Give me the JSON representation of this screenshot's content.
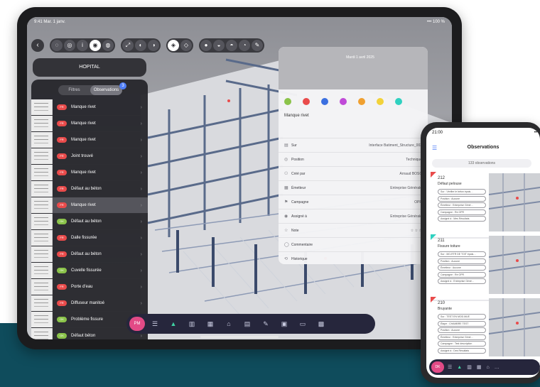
{
  "colors": {
    "teal_band": "#0f4c5c",
    "accent_pink": "#e24a86",
    "accent_green": "#3fd1a3",
    "badge_red": "#e94b4b",
    "badge_green": "#8bc34a"
  },
  "tablet": {
    "status_left": "9:41  Mar. 1 janv.",
    "status_right": "•••  100 %",
    "toolbar": {
      "back_icon": "back-arrow-icon",
      "groups": [
        [
          "tool-a-icon",
          "tool-b-icon",
          "info-icon",
          "view-icon",
          "tool-c-icon"
        ],
        [
          "expand-icon",
          "tool-d-icon",
          "tool-e-icon"
        ],
        [
          "layer-icon",
          "tool-f-icon"
        ],
        [
          "tool-g-icon",
          "tool-h-icon",
          "tool-i-icon",
          "tool-j-icon",
          "pen-icon"
        ]
      ]
    },
    "project_name": "HOPITAL",
    "segments": {
      "filters": "Filtres",
      "observations": "Observations",
      "badge": "3"
    },
    "observations": [
      {
        "badge": "red",
        "badge_text": "FR",
        "title": "Manque rivet"
      },
      {
        "badge": "red",
        "badge_text": "FR",
        "title": "Manque rivet"
      },
      {
        "badge": "red",
        "badge_text": "FR",
        "title": "Manque rivet"
      },
      {
        "badge": "red",
        "badge_text": "FR",
        "title": "Joint trouvé"
      },
      {
        "badge": "red",
        "badge_text": "FR",
        "title": "Manque rivet"
      },
      {
        "badge": "red",
        "badge_text": "FR",
        "title": "Défaut au béton"
      },
      {
        "badge": "red",
        "badge_text": "FR",
        "title": "Manque rivet"
      },
      {
        "badge": "green",
        "badge_text": "OK",
        "title": "Défaut au béton"
      },
      {
        "badge": "red",
        "badge_text": "FR",
        "title": "Dalle fissurée"
      },
      {
        "badge": "red",
        "badge_text": "FR",
        "title": "Défaut au béton"
      },
      {
        "badge": "green",
        "badge_text": "OK",
        "title": "Cuvelle fissurée"
      },
      {
        "badge": "red",
        "badge_text": "FR",
        "title": "Porte d'eau"
      },
      {
        "badge": "red",
        "badge_text": "FR",
        "title": "Diffuseur manitoé"
      },
      {
        "badge": "green",
        "badge_text": "OK",
        "title": "Problème fissure"
      },
      {
        "badge": "green",
        "badge_text": "OK",
        "title": "Défaut béton"
      }
    ],
    "detail": {
      "header": "Mardi 1 avril 2025",
      "title": "Manque rivet",
      "color_swatches": [
        "#8bc34a",
        "#e94b4b",
        "#3b6fe0",
        "#c04ad8",
        "#f0a030",
        "#f2d23a",
        "#2fd1c0"
      ],
      "fields": [
        {
          "icon": "file-icon",
          "label": "Sur",
          "value": "Interface Batiment_Structure_003"
        },
        {
          "icon": "position-icon",
          "label": "Position",
          "value": "Technique"
        },
        {
          "icon": "user-icon",
          "label": "Créé par",
          "value": "Arnaud BOSC"
        },
        {
          "icon": "building-icon",
          "label": "Émetteur",
          "value": "Entreprise Générale"
        },
        {
          "icon": "flag-icon",
          "label": "Campagne",
          "value": "OPR"
        },
        {
          "icon": "assign-icon",
          "label": "Assigné à",
          "value": "Entreprise Générale"
        },
        {
          "icon": "star-icon",
          "label": "Note",
          "value": "☆ ☆ ☆"
        },
        {
          "icon": "comment-icon",
          "label": "Commentaire",
          "value": ""
        },
        {
          "icon": "history-icon",
          "label": "Historique",
          "value": ""
        }
      ]
    },
    "bottom_bar": {
      "avatar": "PM",
      "icons": [
        "list-icon",
        "model-icon",
        "map-icon",
        "grid-icon",
        "tag-icon",
        "doc-icon",
        "pen-icon",
        "cabinet-icon",
        "book-icon",
        "qr-icon"
      ]
    }
  },
  "phone": {
    "status_time": "21:00",
    "status_right": "•••",
    "title": "Observations",
    "count": "133 observations",
    "cards": [
      {
        "number": "212",
        "title": "Défaut pelouse",
        "chips": [
          "Sur : Vérifier le béton épais…",
          "Position : Aucune",
          "Émetteur : Entreprise Géné…",
          "Campagne : Re OPR",
          "Assigné à : Mes Résultats"
        ]
      },
      {
        "number": "211",
        "title": "Fissure toiture",
        "chips": [
          "Sur : MO-RTR DE TOIT épais…",
          "Position : Aucune",
          "Émetteur : Aucune",
          "Campagne : Re OPR",
          "Assigné à : Entreprise Géné…"
        ]
      },
      {
        "number": "210",
        "title": "Bruyante",
        "chips": [
          "Sur : TEST EN MOD.MUE",
          "Étape : CHAMBRE TEST",
          "Position : Aucune",
          "Émetteur : Entreprise Géné…",
          "Campagne : Test description",
          "Assigné à : Des Résultats"
        ]
      }
    ],
    "bottom_bar": {
      "avatar": "DK",
      "icons": [
        "list-icon",
        "model-icon",
        "map-icon",
        "grid-icon",
        "tag-icon",
        "more-icon"
      ]
    }
  }
}
